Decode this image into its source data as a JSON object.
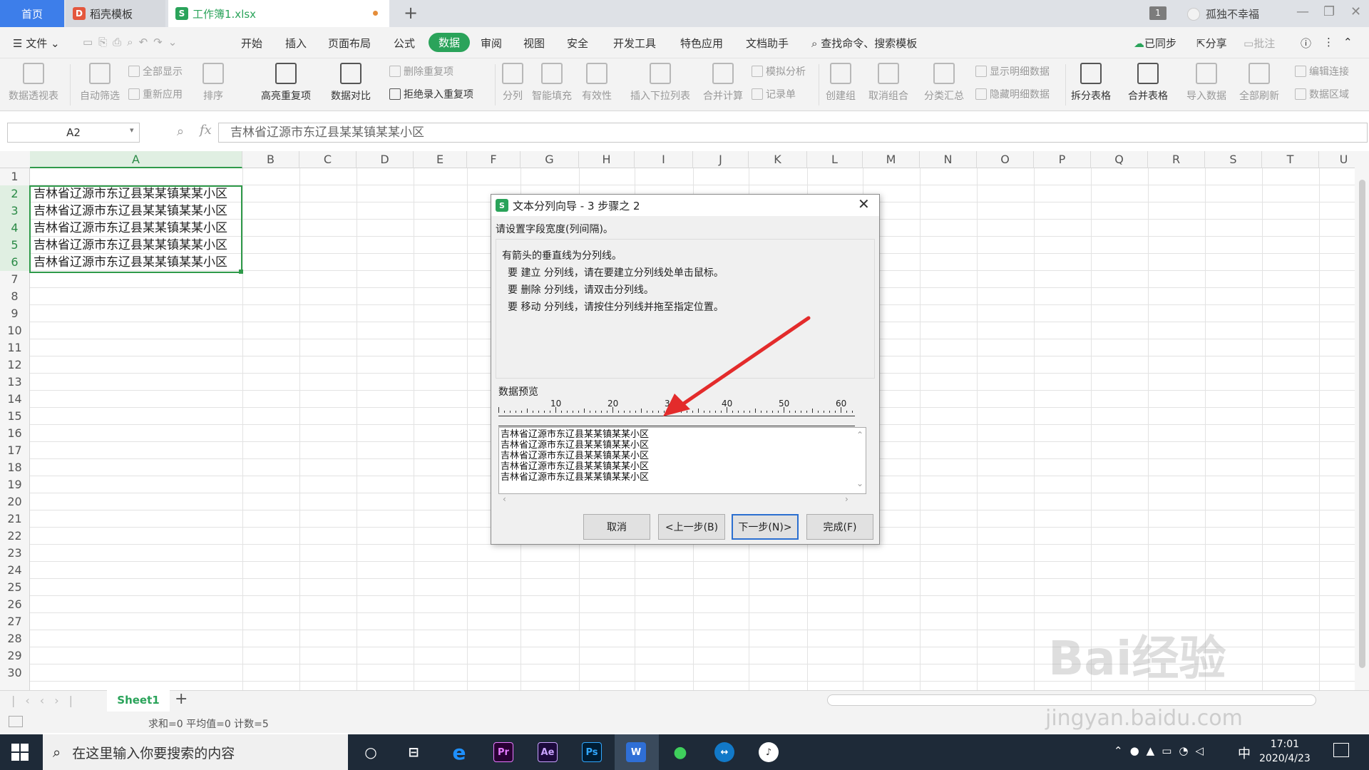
{
  "tabs": {
    "home": "首页",
    "daoke": "稻壳模板",
    "book": "工作簿1.xlsx",
    "add": "+"
  },
  "window": {
    "badge": "1",
    "user": "孤独不幸福",
    "min": "—",
    "restore": "❐",
    "close": "✕"
  },
  "menu": {
    "file": "文件",
    "start": "开始",
    "insert": "插入",
    "layout": "页面布局",
    "formula": "公式",
    "data": "数据",
    "review": "审阅",
    "view": "视图",
    "security": "安全",
    "dev": "开发工具",
    "special": "特色应用",
    "docassist": "文档助手",
    "search": "查找命令、搜索模板",
    "sync": "已同步",
    "share": "分享",
    "comment": "批注"
  },
  "ribbon": {
    "pivot": "数据透视表",
    "autofilter": "自动筛选",
    "showall": "全部显示",
    "reapply": "重新应用",
    "sort": "排序",
    "highlight_dup": "高亮重复项",
    "compare": "数据对比",
    "del_dup": "删除重复项",
    "reject_dup": "拒绝录入重复项",
    "split": "分列",
    "smartfill": "智能填充",
    "validity": "有效性",
    "dropdown": "插入下拉列表",
    "consolidate": "合并计算",
    "simulate": "模拟分析",
    "recordsheet": "记录单",
    "group": "创建组",
    "ungroup": "取消组合",
    "subtotal": "分类汇总",
    "showdetail": "显示明细数据",
    "hidedetail": "隐藏明细数据",
    "splittable": "拆分表格",
    "mergetable": "合并表格",
    "importdata": "导入数据",
    "refreshall": "全部刷新",
    "editlink": "编辑连接",
    "dataarea": "数据区域"
  },
  "formula_bar": {
    "namebox": "A2",
    "fx": "fx",
    "content": "吉林省辽源市东辽县某某镇某某小区"
  },
  "columns": [
    "A",
    "B",
    "C",
    "D",
    "E",
    "F",
    "G",
    "H",
    "I",
    "J",
    "K",
    "L",
    "M",
    "N",
    "O",
    "P",
    "Q",
    "R",
    "S",
    "T",
    "U"
  ],
  "rows": [
    "1",
    "2",
    "3",
    "4",
    "5",
    "6",
    "7",
    "8",
    "9",
    "10",
    "11",
    "12",
    "13",
    "14",
    "15",
    "16",
    "17",
    "18",
    "19",
    "20",
    "21",
    "22",
    "23",
    "24",
    "25",
    "26",
    "27",
    "28",
    "29",
    "30"
  ],
  "cells": [
    "吉林省辽源市东辽县某某镇某某小区",
    "吉林省辽源市东辽县某某镇某某小区",
    "吉林省辽源市东辽县某某镇某某小区",
    "吉林省辽源市东辽县某某镇某某小区",
    "吉林省辽源市东辽县某某镇某某小区"
  ],
  "sheet": {
    "name": "Sheet1",
    "add": "+"
  },
  "status": "求和=0  平均值=0  计数=5",
  "dialog": {
    "title": "文本分列向导 - 3 步骤之 2",
    "subtitle": "请设置字段宽度(列间隔)。",
    "line1": "有箭头的垂直线为分列线。",
    "line2": "要 建立 分列线，请在要建立分列线处单击鼠标。",
    "line3": "要 删除 分列线，请双击分列线。",
    "line4": "要 移动 分列线，请按住分列线并拖至指定位置。",
    "preview_label": "数据预览",
    "ruler": [
      "10",
      "20",
      "30",
      "40",
      "50",
      "60"
    ],
    "preview": [
      "吉林省辽源市东辽县某某镇某某小区",
      "吉林省辽源市东辽县某某镇某某小区",
      "吉林省辽源市东辽县某某镇某某小区",
      "吉林省辽源市东辽县某某镇某某小区",
      "吉林省辽源市东辽县某某镇某某小区"
    ],
    "cancel": "取消",
    "back": "<上一步(B)",
    "next": "下一步(N)>",
    "finish": "完成(F)"
  },
  "taskbar": {
    "search": "在这里输入你要搜索的内容",
    "time": "17:01",
    "date": "2020/4/23",
    "ime": "中"
  },
  "watermark": {
    "brand": "Bai经验",
    "url": "jingyan.baidu.com"
  },
  "colors": {
    "accent": "#2aa35a",
    "home_tab": "#3d7eea",
    "arrow": "#e32b2b",
    "taskbar": "#1e2a38"
  }
}
